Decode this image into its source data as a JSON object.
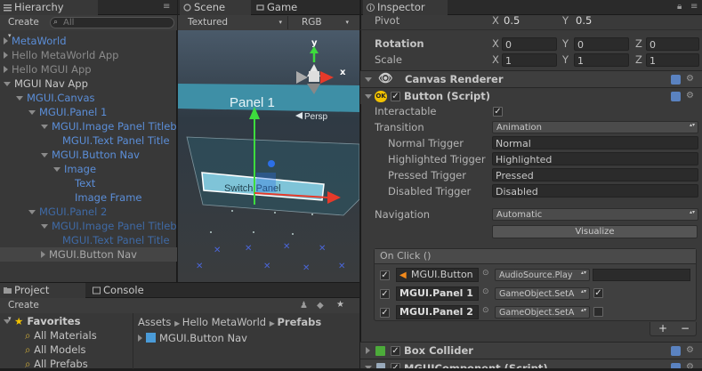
{
  "hierarchy": {
    "tab_label": "Hierarchy",
    "create_label": "Create",
    "search_placeholder": "All",
    "items": [
      {
        "label": "MetaWorld"
      },
      {
        "label": "Hello MetaWorld App"
      },
      {
        "label": "Hello MGUI App"
      },
      {
        "label": "MGUI Nav App"
      },
      {
        "label": "MGUI.Canvas"
      },
      {
        "label": "MGUI.Panel 1"
      },
      {
        "label": "MGUI.Image Panel Titleb"
      },
      {
        "label": "MGUI.Text Panel Title"
      },
      {
        "label": "MGUI.Button Nav"
      },
      {
        "label": "Image"
      },
      {
        "label": "Text"
      },
      {
        "label": "Image Frame"
      },
      {
        "label": "MGUI.Panel 2"
      },
      {
        "label": "MGUI.Image Panel Titleb"
      },
      {
        "label": "MGUI.Text Panel Title"
      },
      {
        "label": "MGUI.Button Nav"
      }
    ]
  },
  "scene": {
    "tab_label": "Scene",
    "game_tab_label": "Game",
    "shading_mode": "Textured",
    "render_mode": "RGB",
    "panel_label": "Panel 1",
    "button_label": "Switch Panel",
    "persp_label": "Persp",
    "gizmo_y": "y",
    "gizmo_x": "x"
  },
  "project": {
    "tab_label": "Project",
    "console_tab_label": "Console",
    "create_label": "Create",
    "favorites_label": "Favorites",
    "favorites": [
      "All Materials",
      "All Models",
      "All Prefabs"
    ],
    "breadcrumb": [
      "Assets",
      "Hello MetaWorld",
      "Prefabs"
    ],
    "asset_item": "MGUI.Button Nav"
  },
  "inspector": {
    "tab_label": "Inspector",
    "pivot": {
      "label": "Pivot",
      "x_label": "X",
      "x": "0.5",
      "y_label": "Y",
      "y": "0.5"
    },
    "rotation": {
      "label": "Rotation",
      "x_label": "X",
      "x": "0",
      "y_label": "Y",
      "y": "0",
      "z_label": "Z",
      "z": "0"
    },
    "scale": {
      "label": "Scale",
      "x_label": "X",
      "x": "1",
      "y_label": "Y",
      "y": "1",
      "z_label": "Z",
      "z": "1"
    },
    "canvas_renderer": "Canvas Renderer",
    "button_component": "Button (Script)",
    "ok_badge": "OK",
    "interactable_label": "Interactable",
    "transition_label": "Transition",
    "transition_value": "Animation",
    "normal_trigger_label": "Normal Trigger",
    "normal_trigger_value": "Normal",
    "highlighted_trigger_label": "Highlighted Trigger",
    "highlighted_trigger_value": "Highlighted",
    "pressed_trigger_label": "Pressed Trigger",
    "pressed_trigger_value": "Pressed",
    "disabled_trigger_label": "Disabled Trigger",
    "disabled_trigger_value": "Disabled",
    "navigation_label": "Navigation",
    "navigation_value": "Automatic",
    "visualize_label": "Visualize",
    "onclick_label": "On Click ()",
    "onclick_rows": [
      {
        "target": "MGUI.Button",
        "function": "AudioSource.Play",
        "param": ""
      },
      {
        "target": "MGUI.Panel 1",
        "function": "GameObject.SetA",
        "param": "checked"
      },
      {
        "target": "MGUI.Panel 2",
        "function": "GameObject.SetA",
        "param": "unchecked"
      }
    ],
    "plus_label": "+",
    "minus_label": "−",
    "box_collider": "Box Collider",
    "mgui_component": "MGUIComponent (Script)"
  },
  "colors": {
    "accent_blue": "#5b8ed8",
    "selected_row": "#3a3a3a",
    "panel_fill": "#3e8fa6",
    "button_fill": "#7fc4d8"
  }
}
